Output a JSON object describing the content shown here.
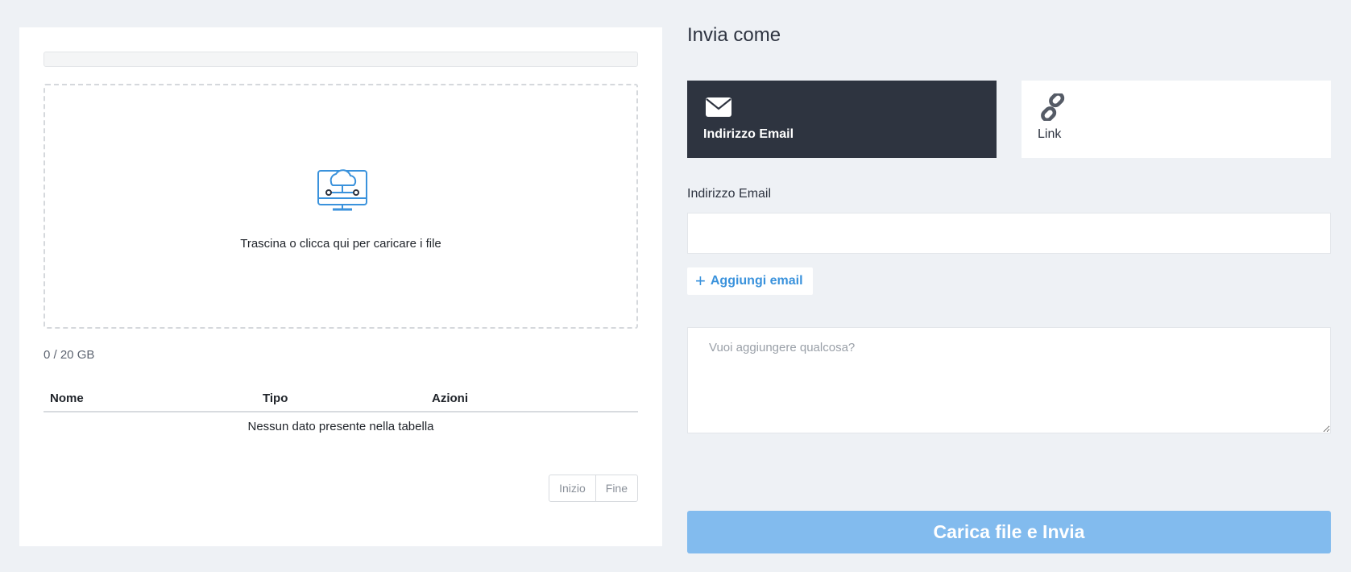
{
  "upload": {
    "progress_percent": 0,
    "dropzone_text": "Trascina o clicca qui per caricare i file",
    "dropzone_icon": "cloud-computer-upload-icon",
    "storage_text": "0 / 20 GB"
  },
  "table": {
    "columns": [
      "Nome",
      "Tipo",
      "Azioni"
    ],
    "empty_text": "Nessun dato presente nella tabella"
  },
  "pagination": {
    "first_label": "Inizio",
    "last_label": "Fine"
  },
  "send": {
    "title": "Invia come",
    "methods": [
      {
        "label": "Indirizzo Email",
        "icon": "envelope-icon",
        "selected": true
      },
      {
        "label": "Link",
        "icon": "link-icon",
        "selected": false
      }
    ],
    "email_label": "Indirizzo Email",
    "email_value": "",
    "add_email_label": "Aggiungi email",
    "message_placeholder": "Vuoi aggiungere qualcosa?",
    "submit_label": "Carica file e Invia"
  },
  "colors": {
    "background": "#eef1f5",
    "selected_card": "#2e3440",
    "accent": "#3a92dc",
    "submit_disabled": "#82bbee"
  }
}
